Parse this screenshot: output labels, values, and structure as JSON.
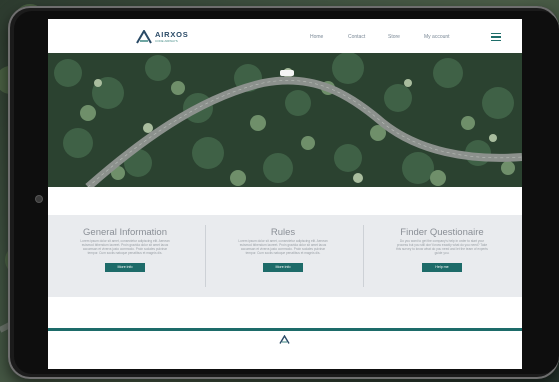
{
  "brand": {
    "name": "AIRXOS",
    "tagline": "CODE AIRWAYS"
  },
  "nav": {
    "items": [
      "Home",
      "Contact",
      "Store",
      "My account"
    ]
  },
  "hero": {
    "image": "aerial forest road"
  },
  "sections": [
    {
      "title": "General Information",
      "text": "Lorem ipsum dolor sit amet, consectetur adipiscing elit. Aenean euismod bibendum laoreet. Proin gravida dolor sit amet lacus accumsan et viverra justo commodo. Proin sodales pulvinar tempor. Cum sociis natoque penatibus et magnis dis.",
      "button": "More info"
    },
    {
      "title": "Rules",
      "text": "Lorem ipsum dolor sit amet, consectetur adipiscing elit. Aenean euismod bibendum laoreet. Proin gravida dolor sit amet lacus accumsan et viverra justo commodo. Proin sodales pulvinar tempor. Cum sociis natoque penatibus et magnis dis.",
      "button": "More info"
    },
    {
      "title": "Finder Questionaire",
      "text": "Do you want to get the company's help in order to start your process but you still don't know exactly what do you need? Take this survey to know what do you need and let the team of experts guide you.",
      "button": "Help me"
    }
  ],
  "colors": {
    "accent": "#1d6b69",
    "brand": "#2a4a66",
    "band": "#e9ebee"
  }
}
